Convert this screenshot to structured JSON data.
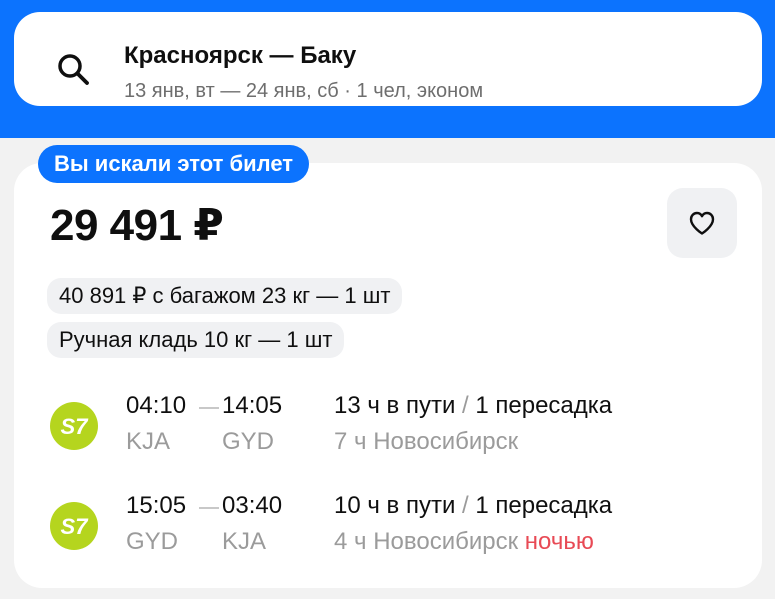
{
  "search": {
    "route": "Красноярск — Баку",
    "details": "13 янв, вт — 24 янв, сб · 1 чел, эконом"
  },
  "ticket": {
    "badge": "Вы искали этот билет",
    "price": "29 491 ₽",
    "baggage_option": "40 891 ₽ с багажом 23 кг — 1 шт",
    "hand_luggage": "Ручная кладь 10 кг — 1 шт",
    "airline_logo_text": "S7",
    "segments": [
      {
        "depart_time": "04:10",
        "arrive_time": "14:05",
        "depart_code": "KJA",
        "arrive_code": "GYD",
        "duration": "13 ч в пути",
        "separator": "/",
        "transfers": "1 пересадка",
        "stopover": "7 ч Новосибирск",
        "stopover_note": ""
      },
      {
        "depart_time": "15:05",
        "arrive_time": "03:40",
        "depart_code": "GYD",
        "arrive_code": "KJA",
        "duration": "10 ч в пути",
        "separator": "/",
        "transfers": "1 пересадка",
        "stopover": "4 ч Новосибирск",
        "stopover_note": "ночью"
      }
    ]
  },
  "icons": {
    "search": "search-icon",
    "favorite": "heart-icon",
    "airline": "s7-airline-logo"
  },
  "colors": {
    "brand_blue": "#0c73fe",
    "airline_green": "#b5d51e",
    "night_warning": "#e84a55",
    "muted_text": "#9b9b9b"
  }
}
